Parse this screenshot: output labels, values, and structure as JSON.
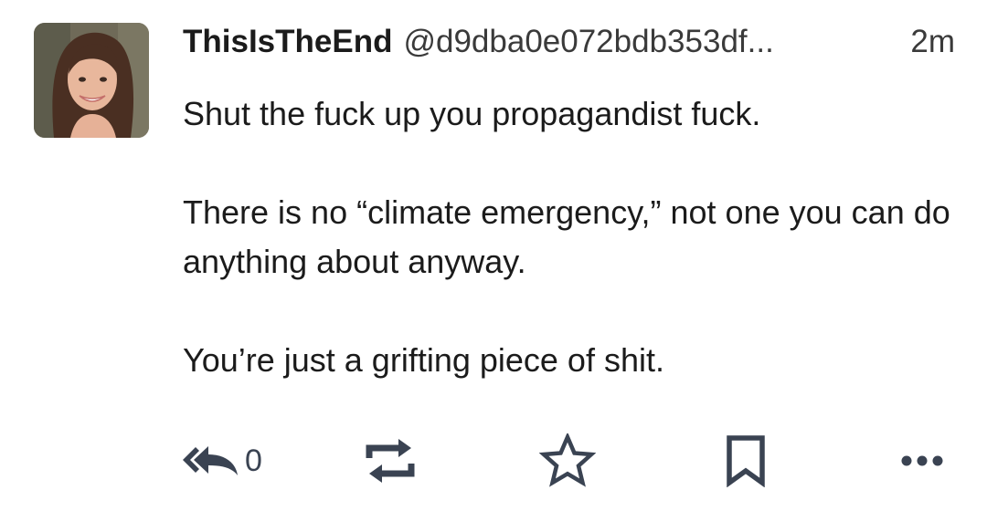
{
  "post": {
    "author": {
      "display_name": "ThisIsTheEnd",
      "handle": "@d9dba0e072bdb353df...",
      "avatar_icon": "avatar-photo"
    },
    "timestamp": "2m",
    "paragraphs": [
      "Shut the fuck up you propagandist fuck.",
      "There is no “climate emergency,” not one you can do anything about anyway.",
      "You’re just a grifting piece of shit."
    ]
  },
  "actions": {
    "reply": {
      "icon": "reply-all-icon",
      "count": "0"
    },
    "boost": {
      "icon": "boost-icon"
    },
    "favourite": {
      "icon": "star-icon"
    },
    "bookmark": {
      "icon": "bookmark-icon"
    },
    "more": {
      "icon": "more-icon"
    }
  },
  "colors": {
    "text": "#1b1b1b",
    "secondary_text": "#3a3a3a",
    "action_icon": "#3a4352",
    "background": "#ffffff"
  }
}
